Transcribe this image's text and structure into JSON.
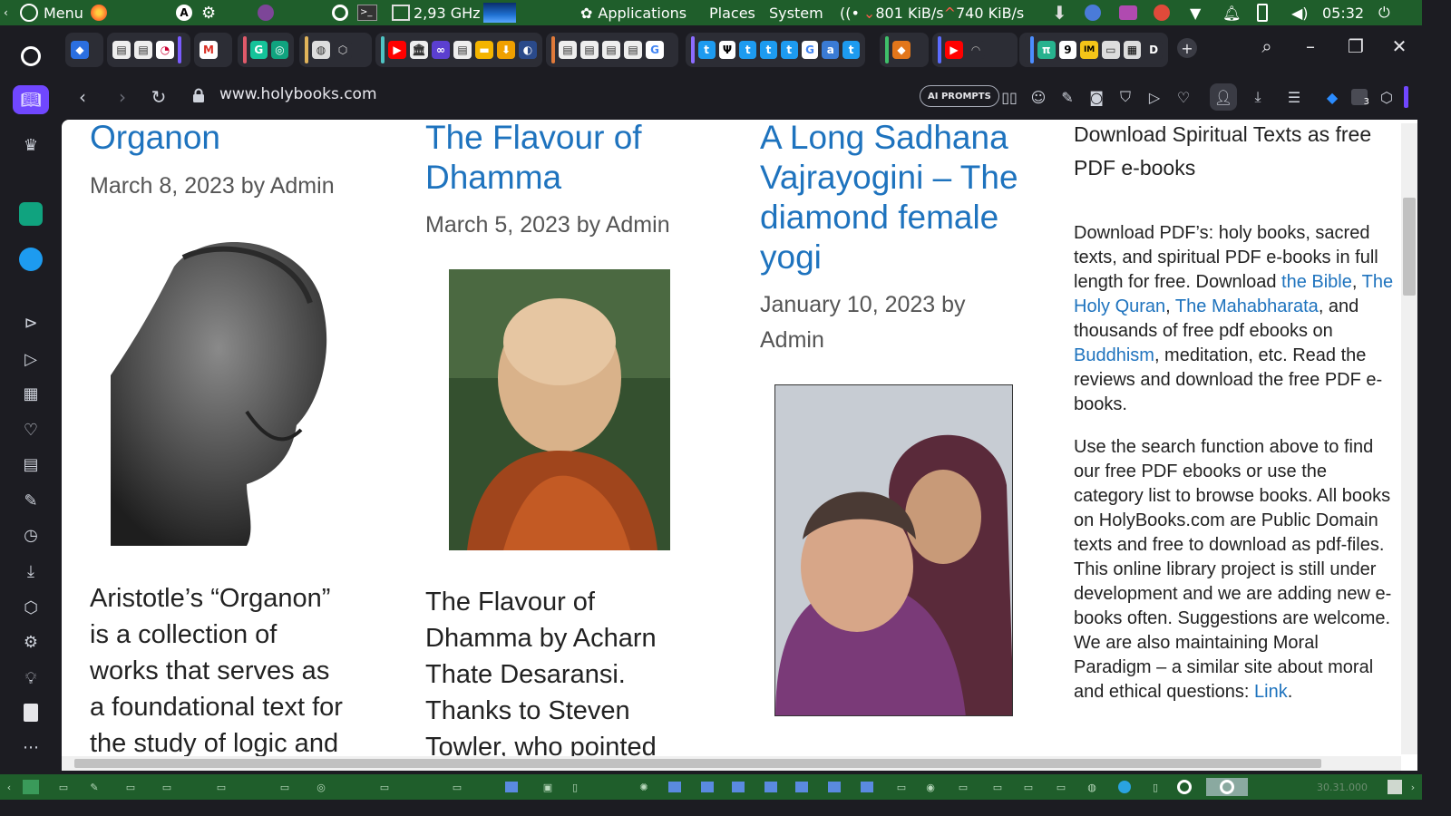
{
  "os_panel": {
    "menu_label": "Menu",
    "cpu_freq": "2,93 GHz",
    "applications": "Applications",
    "places": "Places",
    "system": "System",
    "net_down": "801 KiB/s",
    "net_up": "740 KiB/s",
    "clock": "05:32"
  },
  "browser": {
    "url": "www.holybooks.com",
    "ai_prompts_label": "AI PROMPTS",
    "badge_count": "3",
    "tab_groups": [
      {
        "color": "#4c8dff"
      },
      {
        "color": "#7a5cff"
      },
      {
        "color": "#e05a6a"
      },
      {
        "color": "#e0b35a"
      },
      {
        "color": "#4fc3c3"
      },
      {
        "color": "#e07a3a"
      },
      {
        "color": "#8c6cff"
      },
      {
        "color": "#3fbf6a"
      },
      {
        "color": "#5b6cff"
      },
      {
        "color": "#4c8dff"
      }
    ]
  },
  "posts": [
    {
      "title": "Organon",
      "meta": "March 8, 2023 by Admin",
      "excerpt_lines": [
        "Aristotle’s “Organon”",
        "is a collection of",
        "works that serves as",
        "a foundational text for",
        "the study of logic and"
      ]
    },
    {
      "title_lines": [
        "The Flavour of",
        "Dhamma"
      ],
      "meta": "March 5, 2023 by Admin",
      "excerpt_lines": [
        "The Flavour of",
        "Dhamma by Acharn",
        "Thate Desaransi.",
        "Thanks to Steven",
        "Towler, who pointed"
      ]
    },
    {
      "title_lines": [
        "A Long Sadhana",
        "Vajrayogini – The",
        "diamond female",
        "yogi"
      ],
      "meta_lines": [
        "January 10, 2023 by",
        "Admin"
      ]
    }
  ],
  "sidebar_widget": {
    "heading_lines": [
      "Download Spiritual Texts as free",
      "PDF e-books"
    ],
    "p1_part1": "Download PDF’s: holy books, sacred texts, and spiritual PDF e-books in full length for free. Download ",
    "link_bible": "the Bible",
    "sep1": ", ",
    "link_quran": "The Holy Quran",
    "sep2": ", ",
    "link_mahabharata": "The Mahabharata",
    "p1_part2": ", and thousands of free pdf ebooks on ",
    "link_buddhism": "Buddhism",
    "p1_part3": ", meditation, etc. Read the reviews and download the free PDF e-books.",
    "p2_text": "Use the search function above to find our free PDF ebooks or use the category list to browse books. All books on HolyBooks.com are Public Domain texts and free to download as pdf-files. This online library project is still under development and we are adding new e-books often. Suggestions are welcome. We are also maintaining Moral Paradigm – a similar site about moral and ethical questions: ",
    "link_text": "Link",
    "p2_end": "."
  },
  "taskbar": {
    "clock": "30.31.000"
  }
}
